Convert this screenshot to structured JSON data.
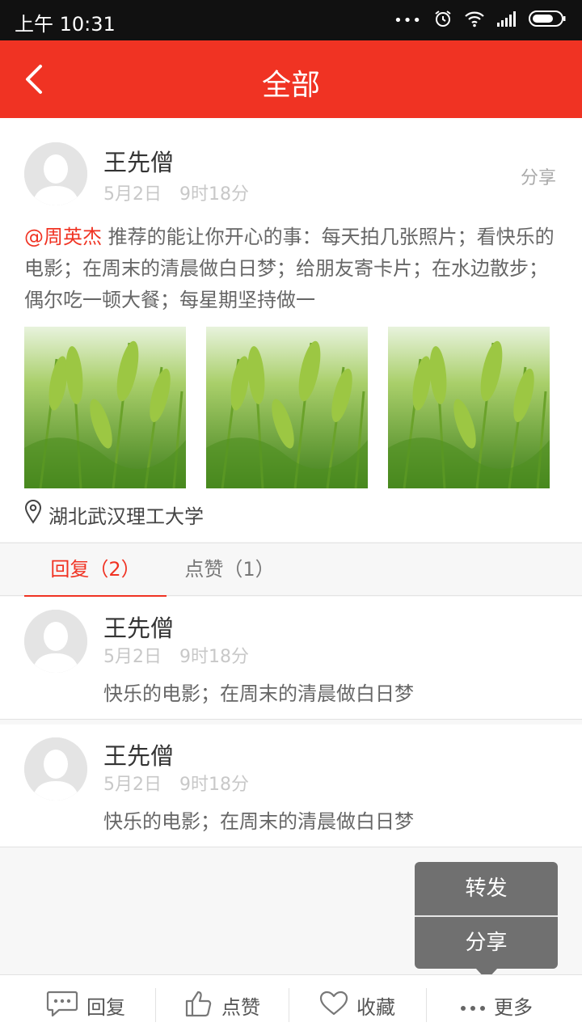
{
  "status_bar": {
    "time": "上午 10:31",
    "more": "•••"
  },
  "header": {
    "title": "全部"
  },
  "post": {
    "author": "王先僧",
    "date": "5月2日",
    "time": "9时18分",
    "share_label": "分享",
    "mention": "@周英杰",
    "text": " 推荐的能让你开心的事：每天拍几张照片；看快乐的电影；在周末的清晨做白日梦；给朋友寄卡片；在水边散步；偶尔吃一顿大餐；每星期坚持做一",
    "location": "湖北武汉理工大学"
  },
  "tabs": [
    {
      "label": "回复（2）"
    },
    {
      "label": "点赞（1）"
    }
  ],
  "replies": [
    {
      "author": "王先僧",
      "date": "5月2日",
      "time": "9时18分",
      "text": "快乐的电影；在周末的清晨做白日梦"
    },
    {
      "author": "王先僧",
      "date": "5月2日",
      "time": "9时18分",
      "text": "快乐的电影；在周末的清晨做白日梦"
    }
  ],
  "popup": {
    "forward": "转发",
    "share": "分享"
  },
  "bottom_bar": {
    "reply": "回复",
    "like": "点赞",
    "favorite": "收藏",
    "more": "更多"
  },
  "colors": {
    "accent": "#f03323",
    "status_bar": "#111111",
    "popup": "#707070"
  },
  "icons": [
    "back-arrow-icon",
    "alarm-icon",
    "wifi-icon",
    "signal-icon",
    "battery-icon",
    "location-pin-icon",
    "comment-icon",
    "thumbs-up-icon",
    "heart-icon",
    "more-dots-icon"
  ]
}
